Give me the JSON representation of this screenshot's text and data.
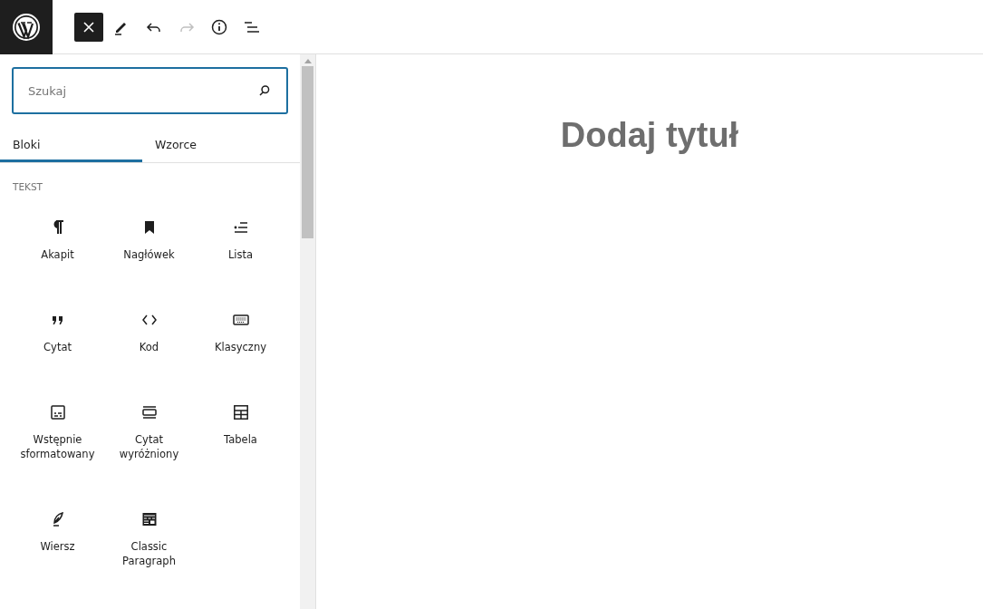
{
  "toolbar": [
    {
      "kind": "close",
      "selected": true,
      "disabled": false
    },
    {
      "kind": "edit",
      "selected": false,
      "disabled": false
    },
    {
      "kind": "undo",
      "selected": false,
      "disabled": false
    },
    {
      "kind": "redo",
      "selected": false,
      "disabled": true
    },
    {
      "kind": "info",
      "selected": false,
      "disabled": false
    },
    {
      "kind": "list",
      "selected": false,
      "disabled": false
    }
  ],
  "inserter": {
    "search": {
      "placeholder": "Szukaj"
    },
    "tabs": [
      {
        "label": "Bloki",
        "selected": true
      },
      {
        "label": "Wzorce",
        "selected": false
      }
    ],
    "category": "TEKST",
    "blocks": [
      {
        "label": "Akapit",
        "kind": "paragraph"
      },
      {
        "label": "Nagłówek",
        "kind": "heading"
      },
      {
        "label": "Lista",
        "kind": "list"
      },
      {
        "label": "Cytat",
        "kind": "quote"
      },
      {
        "label": "Kod",
        "kind": "code"
      },
      {
        "label": "Klasyczny",
        "kind": "keyboard"
      },
      {
        "label": "Wstępnie sformatowany",
        "kind": "preformatted"
      },
      {
        "label": "Cytat wyróżniony",
        "kind": "pullquote"
      },
      {
        "label": "Tabela",
        "kind": "table"
      },
      {
        "label": "Wiersz",
        "kind": "verse"
      },
      {
        "label": "Classic Paragraph",
        "kind": "classic"
      }
    ]
  },
  "editor": {
    "title_placeholder": "Dodaj tytuł"
  }
}
